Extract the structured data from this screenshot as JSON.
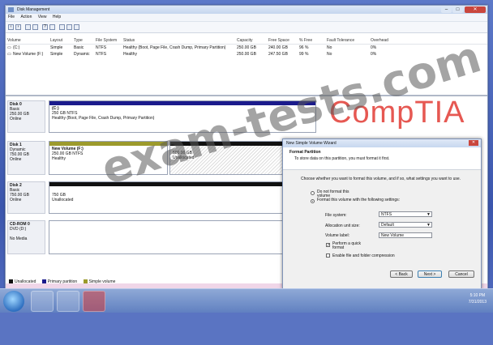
{
  "window": {
    "title": "Disk Management",
    "controls": {
      "min": "–",
      "max": "□",
      "close": "✕"
    }
  },
  "menu": [
    "File",
    "Action",
    "View",
    "Help"
  ],
  "volume_table": {
    "headers": [
      "Volume",
      "Layout",
      "Type",
      "File System",
      "Status",
      "Capacity",
      "Free Space",
      "% Free",
      "Fault Tolerance",
      "Overhead"
    ],
    "rows": [
      [
        "(C:)",
        "Simple",
        "Basic",
        "NTFS",
        "Healthy (Boot, Page File, Crash Dump, Primary Partition)",
        "250.00 GB",
        "240.00 GB",
        "96 %",
        "No",
        "0%"
      ],
      [
        "New Volume (F:)",
        "Simple",
        "Dynamic",
        "NTFS",
        "Healthy",
        "250.00 GB",
        "247.50 GB",
        "99 %",
        "No",
        "0%"
      ]
    ]
  },
  "disks": [
    {
      "name": "Disk 0",
      "type": "Basic",
      "size": "250.00 GB",
      "state": "Online",
      "parts": [
        {
          "title": "(C:)",
          "line1": "250 GB NTFS",
          "line2": "Healthy (Boot, Page File, Crash Dump, Primary Partition)"
        }
      ]
    },
    {
      "name": "Disk 1",
      "type": "Dynamic",
      "size": "750.00 GB",
      "state": "Online",
      "parts": [
        {
          "title": "New Volume (F:)",
          "line1": "250.00 GB NTFS",
          "line2": "Healthy"
        },
        {
          "title": "",
          "line1": "500.00 GB",
          "line2": "Unallocated"
        }
      ]
    },
    {
      "name": "Disk 2",
      "type": "Basic",
      "size": "750.00 GB",
      "state": "Online",
      "parts": [
        {
          "title": "",
          "line1": "750 GB",
          "line2": "Unallocated"
        }
      ]
    },
    {
      "name": "CD-ROM 0",
      "type": "DVD (D:)",
      "size": "",
      "state": "No Media",
      "parts": []
    }
  ],
  "legend": [
    "Unallocated",
    "Primary partition",
    "Simple volume"
  ],
  "colors": {
    "primary": "#1b1b8c",
    "simple": "#9c9a2c",
    "unallocated": "#111111"
  },
  "wizard": {
    "title": "New Simple Volume Wizard",
    "heading": "Format Partition",
    "subheading": "To store data on this partition, you must format it first.",
    "prompt": "Choose whether you want to format this volume, and if so, what settings you want to use.",
    "opt_no_format": "Do not format this volume",
    "opt_format": "Format this volume with the following settings:",
    "fs_label": "File system:",
    "fs_value": "NTFS",
    "alloc_label": "Allocation unit size:",
    "alloc_value": "Default",
    "vol_label": "Volume label:",
    "vol_value": "New Volume",
    "quick_format": "Perform a quick format",
    "compression": "Enable file and folder compression",
    "back": "< Back",
    "next": "Next >",
    "cancel": "Cancel"
  },
  "taskbar": {
    "time": "5:10 PM",
    "date": "7/31/2013"
  },
  "watermarks": {
    "brand": "CompTIA",
    "site": "exam-tests.com"
  }
}
